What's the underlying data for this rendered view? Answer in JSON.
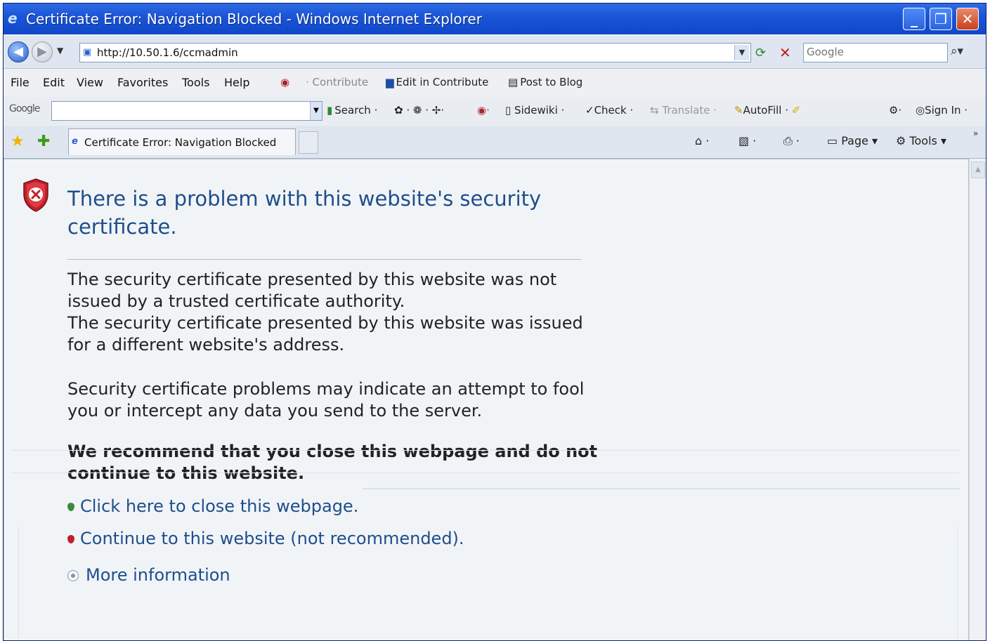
{
  "window": {
    "title": "Certificate Error: Navigation Blocked - Windows Internet Explorer",
    "controls": {
      "minimize": "_",
      "maximize": "❐",
      "close": "✕"
    }
  },
  "address": {
    "url": "http://10.50.1.6/ccmadmin",
    "search_placeholder": "Google"
  },
  "menu": {
    "items": [
      "File",
      "Edit",
      "View",
      "Favorites",
      "Tools",
      "Help"
    ]
  },
  "contribute": {
    "contribute": "Contribute",
    "edit_in_contribute": "Edit in Contribute",
    "post_to_blog": "Post to Blog"
  },
  "google_toolbar": {
    "logo": "Google",
    "search": "Search",
    "sidewiki": "Sidewiki",
    "check": "Check",
    "translate": "Translate",
    "autofill": "AutoFill",
    "sign_in": "Sign In"
  },
  "tabs": {
    "active_tab": "Certificate Error: Navigation Blocked"
  },
  "commandbar": {
    "page": "Page",
    "tools": "Tools"
  },
  "content": {
    "headline": "There is a problem with this website's security certificate.",
    "para1_line1": "The security certificate presented by this website was not issued by a trusted certificate authority.",
    "para1_line2": "The security certificate presented by this website was issued for a different website's address.",
    "para2": "Security certificate problems may indicate an attempt to fool you or intercept any data you send to the server.",
    "recommendation": "We recommend that you close this webpage and do not continue to this website.",
    "link_close": "Click here to close this webpage.",
    "link_continue": "Continue to this website (not recommended).",
    "link_more": "More information"
  },
  "colors": {
    "title_bar": "#1b55d8",
    "link": "#1f4e8c",
    "shield": "#c0202c"
  }
}
